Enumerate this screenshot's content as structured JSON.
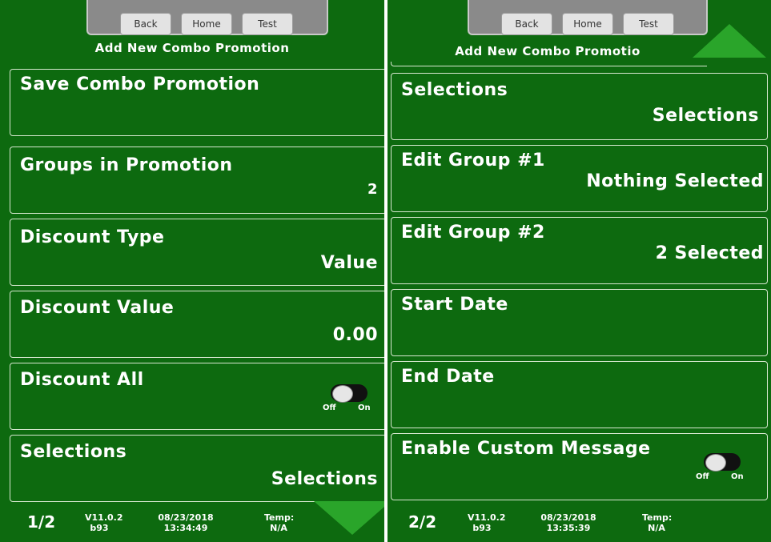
{
  "left": {
    "nav": {
      "back": "Back",
      "home": "Home",
      "test": "Test"
    },
    "title": "Add New Combo Promotion",
    "tiles": {
      "save": {
        "label": "Save Combo Promotion"
      },
      "groups": {
        "label": "Groups in Promotion",
        "value": "2"
      },
      "discount_type": {
        "label": "Discount Type",
        "value": "Value"
      },
      "discount_value": {
        "label": "Discount Value",
        "value": "0.00"
      },
      "discount_all": {
        "label": "Discount All",
        "toggle": {
          "state": "off",
          "off_label": "Off",
          "on_label": "On"
        }
      },
      "selections": {
        "label": "Selections",
        "value": "Selections"
      }
    },
    "footer": {
      "page": "1/2",
      "version": "V11.0.2",
      "build": "b93",
      "date": "08/23/2018",
      "time": "13:34:49",
      "temp_label": "Temp:",
      "temp_value": "N/A"
    }
  },
  "right": {
    "nav": {
      "back": "Back",
      "home": "Home",
      "test": "Test"
    },
    "title": "Add New Combo Promotio",
    "tiles": {
      "selections": {
        "label": "Selections",
        "value": "Selections"
      },
      "edit_group_1": {
        "label": "Edit Group #1",
        "value": "Nothing Selected"
      },
      "edit_group_2": {
        "label": "Edit Group #2",
        "value": "2 Selected"
      },
      "start_date": {
        "label": "Start Date"
      },
      "end_date": {
        "label": "End Date"
      },
      "custom_message": {
        "label": "Enable Custom Message",
        "toggle": {
          "state": "off",
          "off_label": "Off",
          "on_label": "On"
        }
      }
    },
    "footer": {
      "page": "2/2",
      "version": "V11.0.2",
      "build": "b93",
      "date": "08/23/2018",
      "time": "13:35:39",
      "temp_label": "Temp:",
      "temp_value": "N/A"
    }
  },
  "colors": {
    "background": "#0d6a0f",
    "arrow": "#2aa52a",
    "tile_border": "#d7e8d0"
  }
}
